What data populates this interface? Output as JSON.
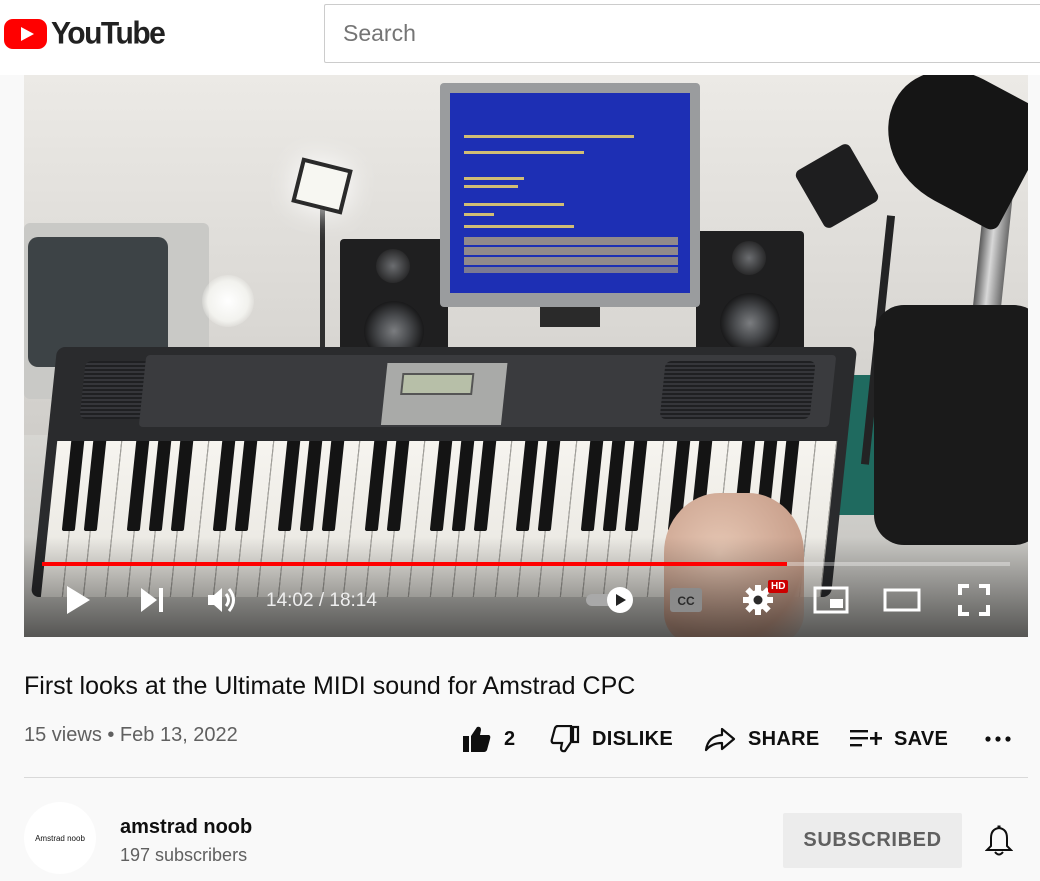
{
  "header": {
    "logo_text": "YouTube",
    "search_placeholder": "Search"
  },
  "player": {
    "current_time": "14:02",
    "duration": "18:14",
    "time_display": "14:02 / 18:14",
    "progress_fraction": 0.77,
    "hd_badge": "HD",
    "controls": [
      "play-icon",
      "next-icon",
      "volume-icon",
      "autoplay-toggle",
      "captions-icon",
      "settings-icon",
      "miniplayer-icon",
      "theater-icon",
      "fullscreen-icon"
    ]
  },
  "video": {
    "title": "First looks at the Ultimate MIDI sound for Amstrad CPC",
    "views": "15 views",
    "separator": "•",
    "date": "Feb 13, 2022",
    "meta_line": "15 views • Feb 13, 2022"
  },
  "actions": {
    "like_count": "2",
    "dislike_label": "DISLIKE",
    "share_label": "SHARE",
    "save_label": "SAVE"
  },
  "channel": {
    "avatar_text": "Amstrad noob",
    "name": "amstrad noob",
    "subscribers": "197 subscribers",
    "subscribe_label": "SUBSCRIBED"
  },
  "colors": {
    "brand_red": "#ff0000",
    "progress_played": "#ff0000",
    "page_background": "#f9f9f9",
    "subscribed_button_bg": "#ececec"
  }
}
